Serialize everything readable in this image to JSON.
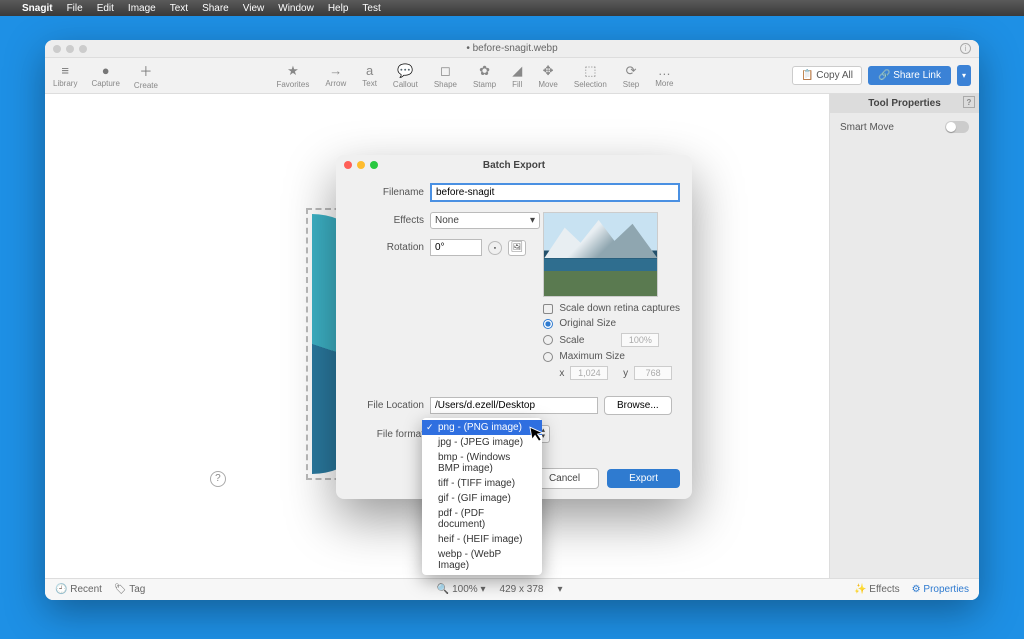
{
  "menubar": {
    "app": "Snagit",
    "items": [
      "File",
      "Edit",
      "Image",
      "Text",
      "Share",
      "View",
      "Window",
      "Help",
      "Test"
    ]
  },
  "window": {
    "title": "• before-snagit.webp",
    "left_tools": [
      {
        "icon": "≡",
        "label": "Library"
      },
      {
        "icon": "●",
        "label": "Capture"
      },
      {
        "icon": "＋",
        "label": "Create"
      }
    ],
    "center_tools": [
      {
        "icon": "★",
        "label": "Favorites"
      },
      {
        "icon": "→",
        "label": "Arrow"
      },
      {
        "icon": "a",
        "label": "Text"
      },
      {
        "icon": "💬",
        "label": "Callout"
      },
      {
        "icon": "◻",
        "label": "Shape"
      },
      {
        "icon": "✿",
        "label": "Stamp"
      },
      {
        "icon": "◢",
        "label": "Fill"
      },
      {
        "icon": "✥",
        "label": "Move"
      },
      {
        "icon": "⬚",
        "label": "Selection"
      },
      {
        "icon": "⟳",
        "label": "Step"
      },
      {
        "icon": "…",
        "label": "More"
      }
    ],
    "copy_all": "Copy All",
    "share_link": "Share Link"
  },
  "props": {
    "header": "Tool Properties",
    "smart_move": "Smart Move"
  },
  "status": {
    "recent": "Recent",
    "tag": "Tag",
    "zoom": "100%",
    "dims": "429 x 378",
    "effects": "Effects",
    "properties": "Properties"
  },
  "modal": {
    "title": "Batch Export",
    "filename_label": "Filename",
    "filename_value": "before-snagit",
    "effects_label": "Effects",
    "effects_value": "None",
    "rotation_label": "Rotation",
    "rotation_value": "0°",
    "scale_down": "Scale down retina captures",
    "original_size": "Original Size",
    "scale": "Scale",
    "scale_pct": "100%",
    "max_size": "Maximum Size",
    "x_label": "x",
    "x_val": "1,024",
    "y_label": "y",
    "y_val": "768",
    "file_location_label": "File Location",
    "file_location_value": "/Users/d.ezell/Desktop",
    "browse": "Browse...",
    "file_format_label": "File format",
    "cancel": "Cancel",
    "export": "Export"
  },
  "format_dropdown": {
    "selected": "png - (PNG image)",
    "options": [
      "png - (PNG image)",
      "jpg - (JPEG image)",
      "bmp - (Windows BMP image)",
      "tiff - (TIFF image)",
      "gif - (GIF image)",
      "pdf - (PDF document)",
      "heif - (HEIF image)",
      "webp - (WebP Image)"
    ]
  }
}
